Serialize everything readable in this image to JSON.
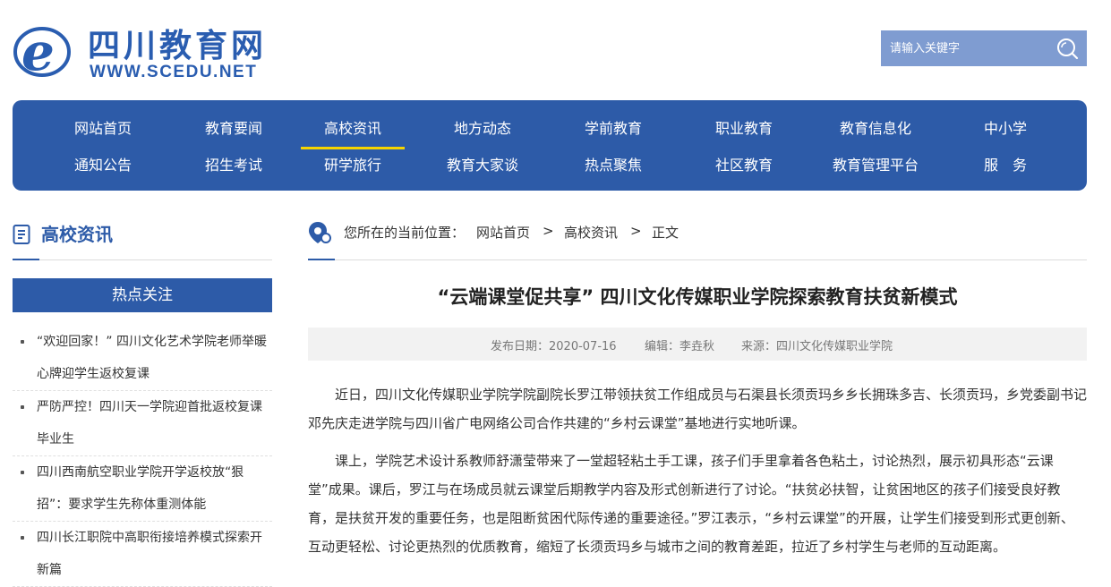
{
  "header": {
    "logo_cn": "四川教育网",
    "logo_en": "WWW.SCEDU.NET",
    "search_placeholder": "请输入关键字"
  },
  "nav": {
    "row1": [
      "网站首页",
      "教育要闻",
      "高校资讯",
      "地方动态",
      "学前教育",
      "职业教育",
      "教育信息化",
      "中小学"
    ],
    "row2": [
      "通知公告",
      "招生考试",
      "研学旅行",
      "教育大家谈",
      "热点聚焦",
      "社区教育",
      "教育管理平台",
      "服　务"
    ],
    "active": "高校资讯"
  },
  "sidebar": {
    "title": "高校资讯",
    "hot_title": "热点关注",
    "items": [
      "“欢迎回家！” 四川文化艺术学院老师举暖心牌迎学生返校复课",
      "严防严控！四川天一学院迎首批返校复课毕业生",
      "四川西南航空职业学院开学返校放“狠招”：要求学生先称体重测体能",
      "四川长江职院中高职衔接培养模式探索开新篇"
    ]
  },
  "breadcrumb": {
    "prefix": "您所在的当前位置：",
    "home": "网站首页",
    "sep": ">",
    "section": "高校资讯",
    "current": "正文"
  },
  "article": {
    "title": "“云端课堂促共享” 四川文化传媒职业学院探索教育扶贫新模式",
    "date": "发布日期：2020-07-16",
    "editor": "编辑：李垚秋",
    "source": "来源：四川文化传媒职业学院",
    "paragraphs": [
      "近日，四川文化传媒职业学院学院副院长罗江带领扶贫工作组成员与石渠县长须贡玛乡乡长拥珠多吉、长须贡玛，乡党委副书记邓先庆走进学院与四川省广电网络公司合作共建的“乡村云课堂”基地进行实地听课。",
      "课上，学院艺术设计系教师舒潇莹带来了一堂超轻粘土手工课，孩子们手里拿着各色粘土，讨论热烈，展示初具形态“云课堂”成果。课后，罗江与在场成员就云课堂后期教学内容及形式创新进行了讨论。“扶贫必扶智，让贫困地区的孩子们接受良好教育，是扶贫开发的重要任务，也是阻断贫困代际传递的重要途径。”罗江表示，“乡村云课堂”的开展，让学生们接受到形式更创新、互动更轻松、讨论更热烈的优质教育，缩短了长须贡玛乡与城市之间的教育差距，拉近了乡村学生与老师的互动距离。"
    ]
  },
  "colors": {
    "brand": "#2d5ba8",
    "nav_active_underline": "#f5d400",
    "search_bg": "#7f9cd1"
  }
}
